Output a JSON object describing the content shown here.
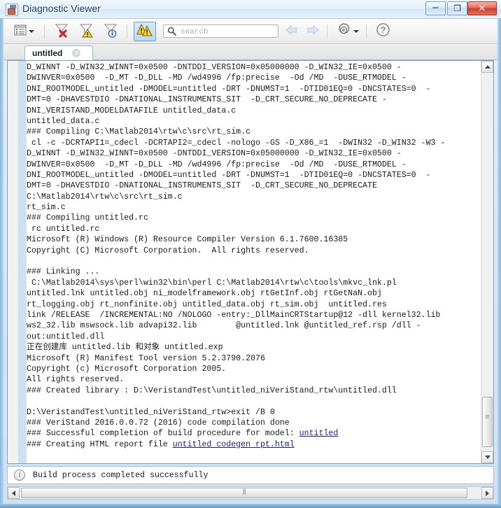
{
  "window": {
    "title": "Diagnostic Viewer",
    "icon": "diagnostic-viewer-icon",
    "minimize_label": "–",
    "maximize_label": "❐",
    "close_label": "✕"
  },
  "toolbar": {
    "items": [
      {
        "name": "view-options-button",
        "icon": "list-view-icon",
        "has_dropdown": true
      },
      {
        "name": "clear-errors-button",
        "icon": "funnel-error-icon"
      },
      {
        "name": "filter-warnings-button",
        "icon": "funnel-warning-icon"
      },
      {
        "name": "filter-info-button",
        "icon": "funnel-info-icon"
      },
      {
        "name": "show-warnings-toggle",
        "icon": "warnings-stack-icon",
        "pressed": true
      },
      {
        "name": "back-button",
        "icon": "arrow-left-icon",
        "disabled": true
      },
      {
        "name": "forward-button",
        "icon": "arrow-right-icon",
        "disabled": true
      },
      {
        "name": "settings-button",
        "icon": "gear-icon",
        "has_dropdown": true
      },
      {
        "name": "help-button",
        "icon": "question-mark-icon"
      }
    ],
    "search": {
      "placeholder": "search",
      "value": "",
      "icon": "search-icon"
    }
  },
  "tabs": [
    {
      "label": "untitled",
      "active": true,
      "close_label": "✕"
    }
  ],
  "log": {
    "lines": [
      {
        "text": "D_WINNT -D_WIN32_WINNT=0x0500 -DNTDDI_VERSION=0x05000000 -D_WIN32_IE=0x0500 -"
      },
      {
        "text": "DWINVER=0x0500  -D_MT -D_DLL -MD /wd4996 /fp:precise  -Od /MD  -DUSE_RTMODEL -"
      },
      {
        "text": "DNI_ROOTMODEL_untitled -DMODEL=untitled -DRT -DNUMST=1  -DTID01EQ=0 -DNCSTATES=0  -"
      },
      {
        "text": "DMT=0 -DHAVESTDIO -DNATIONAL_INSTRUMENTS_SIT  -D_CRT_SECURE_NO_DEPRECATE -"
      },
      {
        "text": "DNI_VERISTAND_MODELDATAFILE untitled_data.c"
      },
      {
        "text": "untitled_data.c"
      },
      {
        "text": "### Compiling C:\\Matlab2014\\rtw\\c\\src\\rt_sim.c"
      },
      {
        "text": " cl -c -DCRTAPI1=_cdecl -DCRTAPI2=_cdecl -nologo -GS -D_X86_=1  -DWIN32 -D_WIN32 -W3 -"
      },
      {
        "text": "D_WINNT -D_WIN32_WINNT=0x0500 -DNTDDI_VERSION=0x05000000 -D_WIN32_IE=0x0500 -"
      },
      {
        "text": "DWINVER=0x0500  -D_MT -D_DLL -MD /wd4996 /fp:precise  -Od /MD  -DUSE_RTMODEL -"
      },
      {
        "text": "DNI_ROOTMODEL_untitled -DMODEL=untitled -DRT -DNUMST=1  -DTID01EQ=0 -DNCSTATES=0  -"
      },
      {
        "text": "DMT=0 -DHAVESTDIO -DNATIONAL_INSTRUMENTS_SIT  -D_CRT_SECURE_NO_DEPRECATE"
      },
      {
        "text": "C:\\Matlab2014\\rtw\\c\\src\\rt_sim.c"
      },
      {
        "text": "rt_sim.c"
      },
      {
        "text": "### Compiling untitled.rc"
      },
      {
        "text": " rc untitled.rc"
      },
      {
        "text": "Microsoft (R) Windows (R) Resource Compiler Version 6.1.7600.16385"
      },
      {
        "text": "Copyright (C) Microsoft Corporation.  All rights reserved."
      },
      {
        "text": ""
      },
      {
        "text": "### Linking ..."
      },
      {
        "text": " C:\\Matlab2014\\sys\\perl\\win32\\bin\\perl C:\\Matlab2014\\rtw\\c\\tools\\mkvc_lnk.pl"
      },
      {
        "text": "untitled.lnk untitled.obj ni_modelframework.obj rtGetInf.obj rtGetNaN.obj"
      },
      {
        "text": "rt_logging.obj rt_nonfinite.obj untitled_data.obj rt_sim.obj  untitled.res"
      },
      {
        "text": "link /RELEASE  /INCREMENTAL:NO /NOLOGO -entry:_DllMainCRTStartup@12 -dll kernel32.lib"
      },
      {
        "text": "ws2_32.lib mswsock.lib advapi32.lib        @untitled.lnk @untitled_ref.rsp /dll -"
      },
      {
        "text": "out:untitled.dll"
      },
      {
        "text": "正在创建库 untitled.lib 和对象 untitled.exp"
      },
      {
        "text": "Microsoft (R) Manifest Tool version 5.2.3790.2076"
      },
      {
        "text": "Copyright (c) Microsoft Corporation 2005."
      },
      {
        "text": "All rights reserved."
      },
      {
        "text": "### Created library : D:\\VeristandTest\\untitled_niVeriStand_rtw\\untitled.dll"
      },
      {
        "text": ""
      },
      {
        "text": "D:\\VeristandTest\\untitled_niVeriStand_rtw>exit /B 0"
      },
      {
        "text": "### VeriStand 2016.0.0.72 (2016) code compilation done"
      },
      {
        "text": "### Successful completion of build procedure for model: ",
        "link": "untitled"
      },
      {
        "text": "### Creating HTML report file ",
        "link": "untitled codegen rpt.html"
      }
    ],
    "link_color": "#1a1a8c"
  },
  "status": {
    "icon": "info-circle-icon",
    "text": "Build process completed successfully"
  },
  "scrollbars": {
    "vertical": {
      "up": "▲",
      "down": "▼",
      "grip": "≡"
    },
    "horizontal": {
      "left": "◀",
      "right": "▶",
      "grip": "⦀"
    }
  }
}
